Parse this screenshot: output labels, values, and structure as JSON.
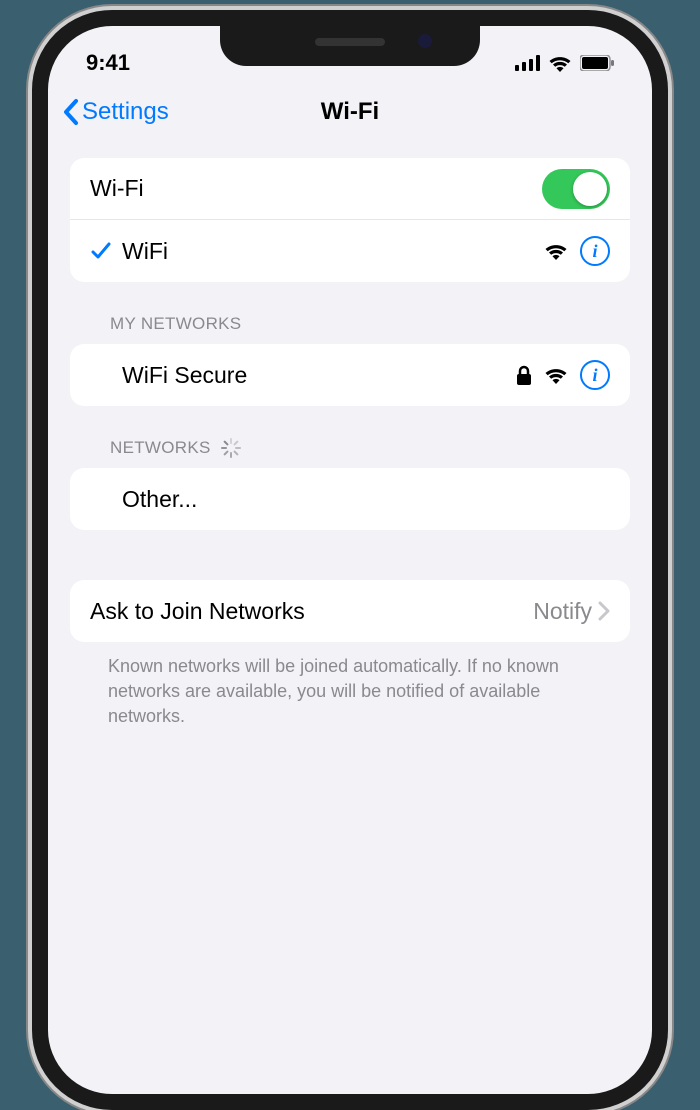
{
  "status_bar": {
    "time": "9:41"
  },
  "nav": {
    "back_label": "Settings",
    "title": "Wi-Fi"
  },
  "wifi_toggle": {
    "label": "Wi-Fi",
    "enabled": true
  },
  "connected_network": {
    "name": "WiFi"
  },
  "sections": {
    "my_networks": {
      "header": "MY NETWORKS",
      "items": [
        {
          "name": "WiFi Secure",
          "locked": true
        }
      ]
    },
    "networks": {
      "header": "NETWORKS",
      "other_label": "Other..."
    }
  },
  "ask_to_join": {
    "label": "Ask to Join Networks",
    "value": "Notify"
  },
  "footer": "Known networks will be joined automatically. If no known networks are available, you will be notified of available networks."
}
